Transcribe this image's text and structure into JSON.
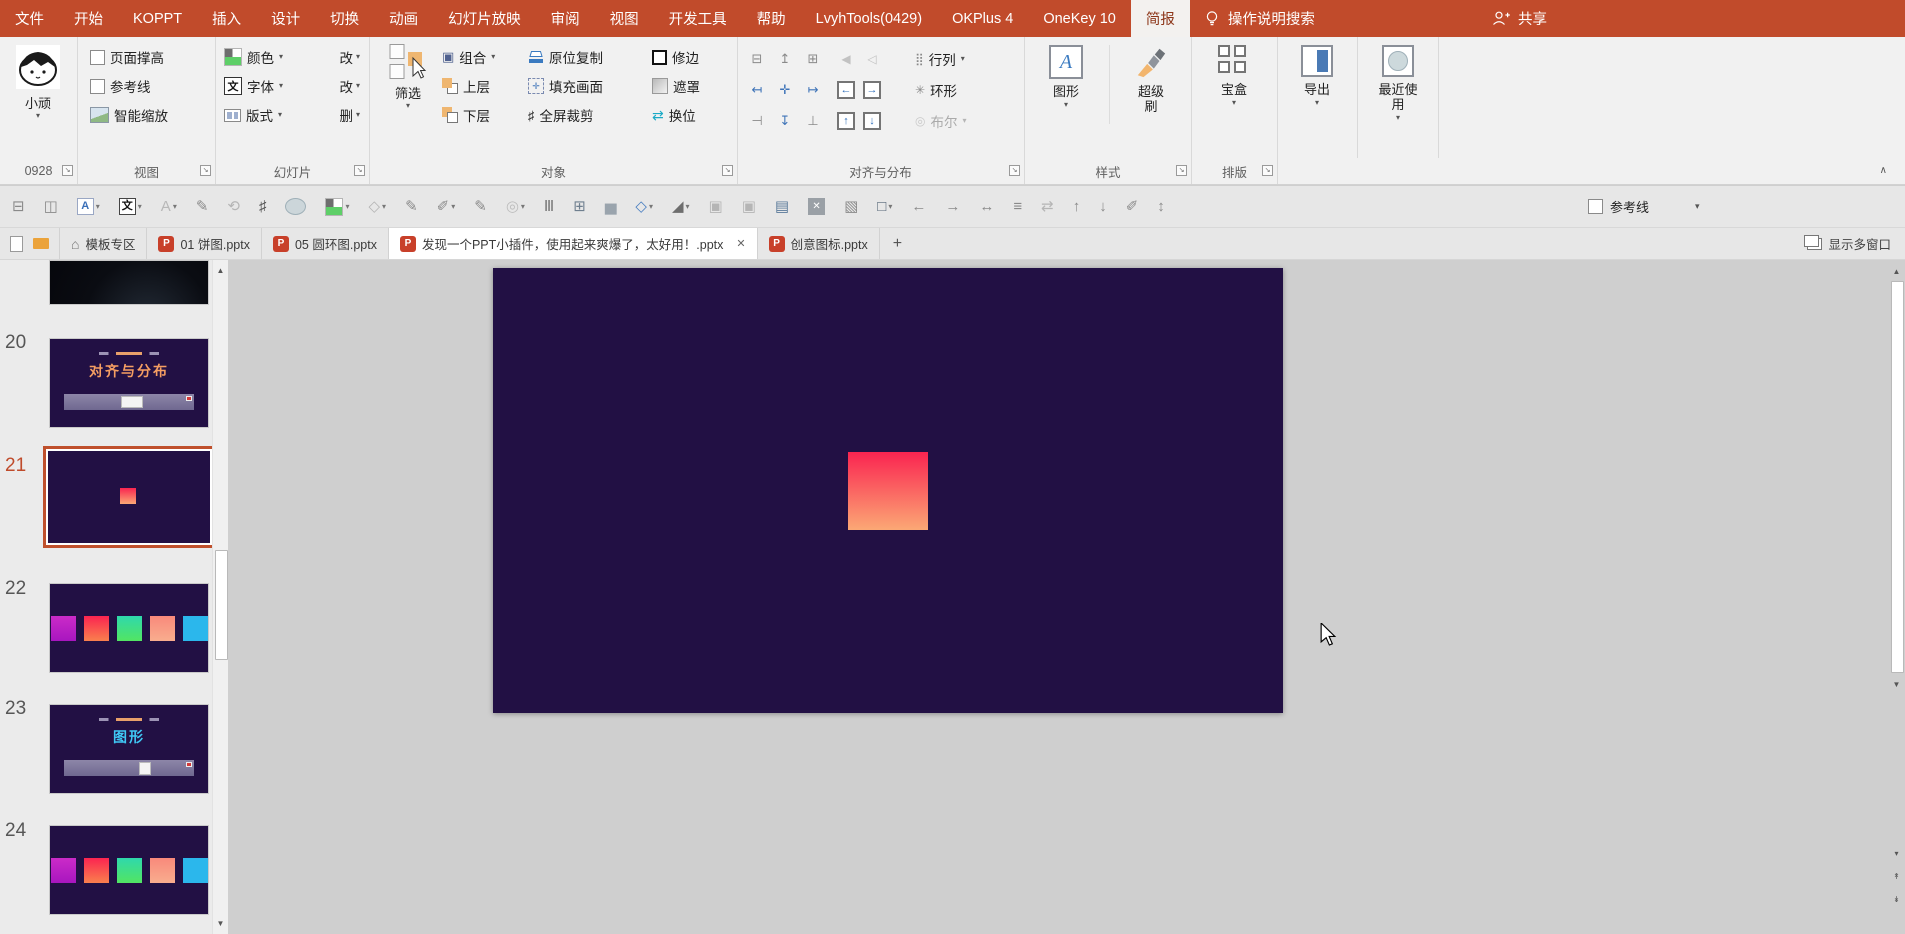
{
  "colors": {
    "brand_red": "#c14b2b",
    "selection_orange": "#bf502c",
    "slide_bg": "#221044",
    "square_top": "#fa2450",
    "square_bottom": "#fba875",
    "canvas_gray": "#cfcfcf"
  },
  "menu": {
    "tabs": [
      "文件",
      "开始",
      "KOPPT",
      "插入",
      "设计",
      "切换",
      "动画",
      "幻灯片放映",
      "审阅",
      "视图",
      "开发工具",
      "帮助",
      "LvyhTools(0429)",
      "OKPlus 4",
      "OneKey 10",
      "简报"
    ],
    "active_tab": "简报",
    "search_hint": "操作说明搜索",
    "share": "共享"
  },
  "ribbon": {
    "profile_name": "小顽",
    "group_labels": [
      "0928",
      "视图",
      "幻灯片",
      "对象",
      "对齐与分布",
      "样式",
      "排版"
    ],
    "view": {
      "check1": "页面撑高",
      "check2": "参考线",
      "zoom": "智能缩放"
    },
    "slide": {
      "color": "颜色",
      "mod1": "改",
      "font": "字体",
      "mod2": "改",
      "layout": "版式",
      "del": "删"
    },
    "object": {
      "filter": "筛选",
      "group": "组合",
      "up": "上层",
      "down": "下层",
      "copy": "原位复制",
      "fill": "填充画面",
      "crop": "全屏裁剪",
      "trim": "修边",
      "mask": "遮罩",
      "swap": "换位"
    },
    "align": {
      "rows": "行列",
      "ring": "环形",
      "bool": "布尔"
    },
    "style": {
      "shape": "图形",
      "brush": "超级刷"
    },
    "compose": {
      "box": "宝盒"
    },
    "export": "导出",
    "recent": "最近使用"
  },
  "qat": {
    "guide": "参考线",
    "icons": [
      {
        "n": "align-middle-icon",
        "g": "⊟",
        "c": "#8a8a8a"
      },
      {
        "n": "distribute-center-icon",
        "g": "◫",
        "c": "#8a8a8a"
      },
      {
        "n": "text-style-icon",
        "t": "abox",
        "cr": 1
      },
      {
        "n": "font-wen-icon",
        "t": "wen",
        "cr": 1
      },
      {
        "n": "font-disabled-icon",
        "g": "A",
        "c": "#b8b8b8",
        "cr": 1
      },
      {
        "n": "eyedropper-icon",
        "g": "✎",
        "c": "#8a8a8a"
      },
      {
        "n": "image-restore-icon",
        "g": "⟲",
        "c": "#b5b5b5"
      },
      {
        "n": "crop-anchor-icon",
        "g": "♯",
        "c": "#555555"
      },
      {
        "n": "oval-shape-icon",
        "t": "oval"
      },
      {
        "n": "fill-color-icon",
        "t": "swatch",
        "cr": 1
      },
      {
        "n": "paint-bucket-icon",
        "g": "◇",
        "c": "#b5b5b5",
        "cr": 1
      },
      {
        "n": "eyedropper2-icon",
        "g": "✎",
        "c": "#8a8a8a"
      },
      {
        "n": "shape-edit-icon",
        "g": "✐",
        "c": "#8a8a8a",
        "cr": 1
      },
      {
        "n": "eyedropper3-icon",
        "g": "✎",
        "c": "#8a8a8a"
      },
      {
        "n": "boolean-circles-icon",
        "g": "◎",
        "c": "#bdbdbd",
        "cr": 1
      },
      {
        "n": "columns-icon",
        "g": "Ⅲ",
        "c": "#777777"
      },
      {
        "n": "table-edit-icon",
        "g": "⊞",
        "c": "#6f7f8f"
      },
      {
        "n": "bar-chart-icon",
        "g": "▅",
        "c": "#9aa4ad"
      },
      {
        "n": "shapes-icon",
        "g": "◇",
        "c": "#4a7fc1",
        "cr": 1
      },
      {
        "n": "flip-shadow-icon",
        "g": "◢",
        "c": "#6e6e6e",
        "cr": 1
      },
      {
        "n": "layer-front-icon",
        "g": "▣",
        "c": "#b5b5b5"
      },
      {
        "n": "layer-back-icon",
        "g": "▣",
        "c": "#b5b5b5"
      },
      {
        "n": "textbox-icon",
        "g": "▤",
        "c": "#5a7a9a"
      },
      {
        "n": "delete-x-icon",
        "t": "xbox"
      },
      {
        "n": "select-objects-icon",
        "g": "▧",
        "c": "#8a8a8a"
      },
      {
        "n": "frame-crop-icon",
        "g": "□",
        "c": "#556677",
        "cr": 1
      },
      {
        "n": "align-left-edge-icon",
        "g": "←",
        "c": "#8a8a8a"
      },
      {
        "n": "align-right-edge-icon",
        "g": "→",
        "c": "#8a8a8a"
      },
      {
        "n": "distribute-horizontal-icon",
        "g": "↔",
        "c": "#8a8a8a"
      },
      {
        "n": "swap-position-icon",
        "g": "≡",
        "c": "#8a8a8a"
      },
      {
        "n": "replace-image-icon",
        "g": "⇄",
        "c": "#b5b5b5"
      },
      {
        "n": "align-top-edge-icon",
        "g": "↑",
        "c": "#8a8a8a"
      },
      {
        "n": "align-bottom-edge-icon",
        "g": "↓",
        "c": "#8a8a8a"
      },
      {
        "n": "format-brush-icon",
        "g": "✐",
        "c": "#8a8a8a"
      },
      {
        "n": "equal-height-icon",
        "g": "↕",
        "c": "#8a8a8a"
      }
    ]
  },
  "tabbar": {
    "tabs": [
      "模板专区",
      "01 饼图.pptx",
      "05 圆环图.pptx",
      "发现一个PPT小插件，使用起来爽爆了，太好用！.pptx",
      "创意图标.pptx"
    ],
    "active": "发现一个PPT小插件，使用起来爽爆了，太好用！.pptx",
    "multi_window": "显示多窗口"
  },
  "slides": {
    "numbers": [
      "20",
      "21",
      "22",
      "23",
      "24"
    ],
    "selected": "21",
    "titles": {
      "s20": "对齐与分布",
      "s23": "图形"
    },
    "square_colors": [
      {
        "top": "#cb2bc8",
        "bottom": "#a816bf"
      },
      {
        "top": "#fb2450",
        "bottom": "#f9804e"
      },
      {
        "top": "#2fd8ac",
        "bottom": "#52e562"
      },
      {
        "top": "#f9897b",
        "bottom": "#f9ad8e"
      },
      {
        "top": "#2bb7ec",
        "bottom": "#2bb7ec"
      }
    ]
  }
}
